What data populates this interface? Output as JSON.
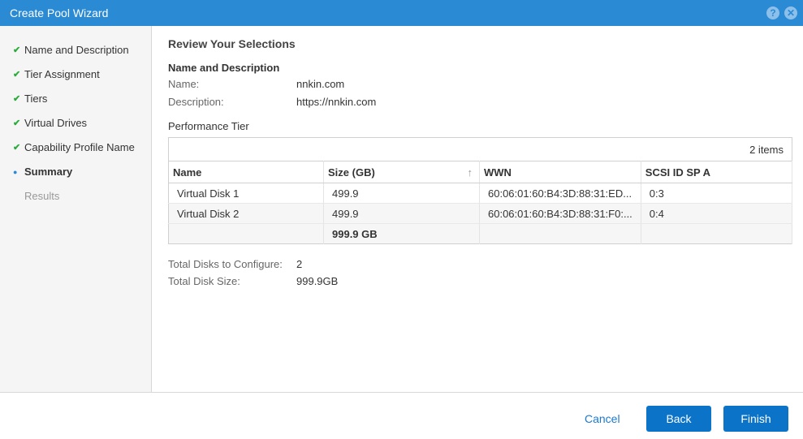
{
  "title": "Create Pool Wizard",
  "steps": [
    {
      "label": "Name and Description",
      "state": "done"
    },
    {
      "label": "Tier Assignment",
      "state": "done"
    },
    {
      "label": "Tiers",
      "state": "done"
    },
    {
      "label": "Virtual Drives",
      "state": "done"
    },
    {
      "label": "Capability Profile Name",
      "state": "done"
    },
    {
      "label": "Summary",
      "state": "active"
    },
    {
      "label": "Results",
      "state": "future"
    }
  ],
  "review": {
    "heading": "Review Your Selections",
    "section": "Name and Description",
    "name_label": "Name:",
    "name_value": "nnkin.com",
    "desc_label": "Description:",
    "desc_value": "https://nnkin.com",
    "tier_label": "Performance Tier"
  },
  "table": {
    "count": "2 items",
    "headers": [
      "Name",
      "Size (GB)",
      "WWN",
      "SCSI ID SP A"
    ],
    "rows": [
      [
        "Virtual Disk 1",
        "499.9",
        "60:06:01:60:B4:3D:88:31:ED...",
        "0:3"
      ],
      [
        "Virtual Disk 2",
        "499.9",
        "60:06:01:60:B4:3D:88:31:F0:...",
        "0:4"
      ]
    ],
    "total": "999.9 GB"
  },
  "totals": {
    "disks_label": "Total Disks to Configure:",
    "disks_value": "2",
    "size_label": "Total Disk Size:",
    "size_value": "999.9GB"
  },
  "footer": {
    "cancel": "Cancel",
    "back": "Back",
    "finish": "Finish"
  },
  "icons": {
    "help": "?",
    "close": "✕"
  }
}
